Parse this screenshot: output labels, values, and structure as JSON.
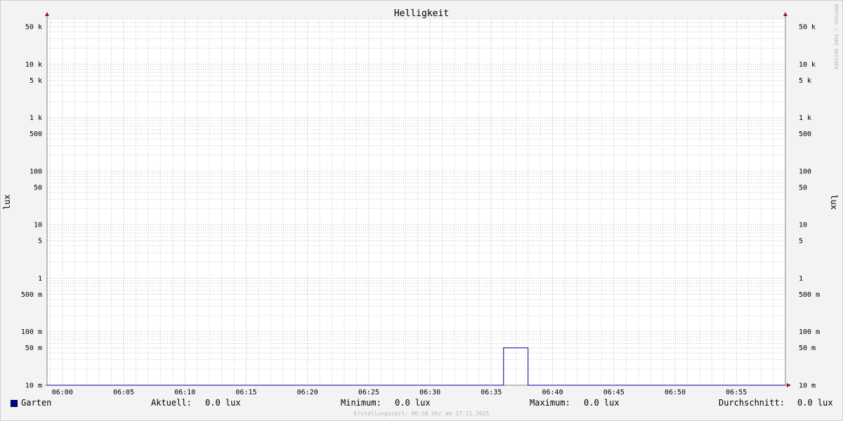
{
  "chart_data": {
    "type": "line",
    "title": "Helligkeit",
    "ylabel": "lux",
    "scale": "log",
    "ylim": [
      0.01,
      70000
    ],
    "xlim": [
      "05:58:45",
      "06:59:00"
    ],
    "y_ticks": [
      {
        "value": 50000,
        "label": "50 k"
      },
      {
        "value": 10000,
        "label": "10 k"
      },
      {
        "value": 5000,
        "label": "5 k"
      },
      {
        "value": 1000,
        "label": "1 k"
      },
      {
        "value": 500,
        "label": "500"
      },
      {
        "value": 100,
        "label": "100"
      },
      {
        "value": 50,
        "label": "50"
      },
      {
        "value": 10,
        "label": "10"
      },
      {
        "value": 5,
        "label": "5"
      },
      {
        "value": 1,
        "label": "1"
      },
      {
        "value": 0.5,
        "label": "500 m"
      },
      {
        "value": 0.1,
        "label": "100 m"
      },
      {
        "value": 0.05,
        "label": "50 m"
      },
      {
        "value": 0.01,
        "label": "10 m"
      }
    ],
    "x_ticks": [
      "06:00",
      "06:05",
      "06:10",
      "06:15",
      "06:20",
      "06:25",
      "06:30",
      "06:35",
      "06:40",
      "06:45",
      "06:50",
      "06:55"
    ],
    "grid": true,
    "series": [
      {
        "name": "Garten",
        "color": "#0000a0",
        "points": [
          {
            "x": "05:58:45",
            "y": 0
          },
          {
            "x": "06:36:00",
            "y": 0
          },
          {
            "x": "06:36:00",
            "y": 0.05
          },
          {
            "x": "06:38:00",
            "y": 0.05
          },
          {
            "x": "06:38:00",
            "y": 0
          },
          {
            "x": "06:59:00",
            "y": 0
          }
        ]
      }
    ]
  },
  "legend": {
    "series_name": "Garten",
    "current_label": "Aktuell:",
    "current_value": "0.0 lux",
    "min_label": "Minimum:",
    "min_value": "0.0 lux",
    "max_label": "Maximum:",
    "max_value": "0.0 lux",
    "avg_label": "Durchschnitt:",
    "avg_value": "0.0 lux"
  },
  "footer": "Erstellungszeit: 06:58 Uhr am 27.11.2025",
  "watermark": "RRDTOOL / TOBI OETIKER",
  "colors": {
    "series": "#0000a0",
    "major_grid": "#e8a6a6",
    "minor_grid": "#c8c8c8",
    "axis": "#808080",
    "arrow": "#9a1a1a"
  }
}
